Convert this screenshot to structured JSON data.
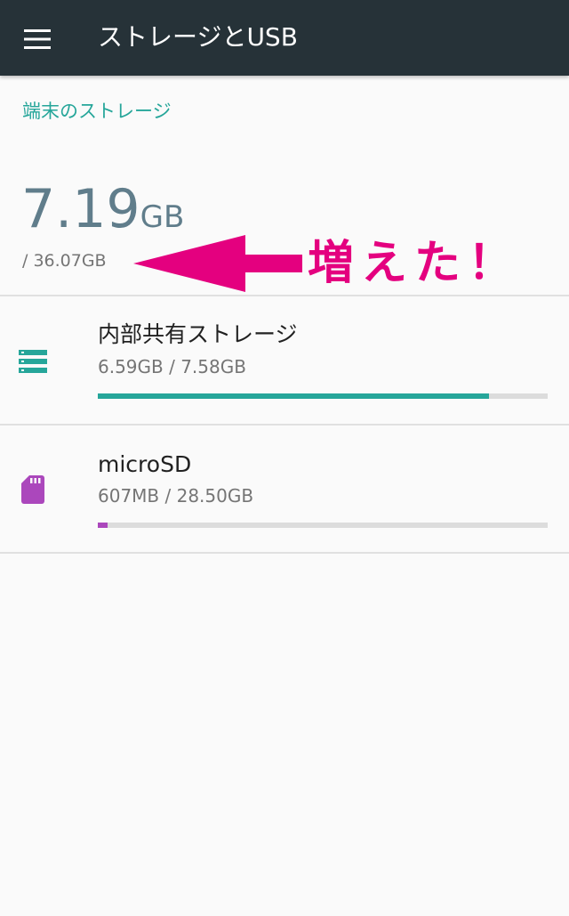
{
  "appbar": {
    "title": "ストレージとUSB",
    "menu_icon": "hamburger-menu-icon"
  },
  "device_storage": {
    "header": "端末のストレージ",
    "used_value": "7.19",
    "used_unit": "GB",
    "total": "/ 36.07GB"
  },
  "annotation": {
    "text": "増えた！",
    "color": "#e4007f",
    "arrow_icon": "left-arrow-icon"
  },
  "volumes": [
    {
      "title": "内部共有ストレージ",
      "summary": "6.59GB / 7.58GB",
      "used_fraction": 0.87,
      "icon": "storage-list-icon",
      "color": "#26a69a"
    },
    {
      "title": "microSD",
      "summary": "607MB / 28.50GB",
      "used_fraction": 0.021,
      "icon": "sd-card-icon",
      "color": "#ab47bc"
    }
  ],
  "colors": {
    "appbar": "#263238",
    "accent": "#26a69a",
    "summary_text": "#607d8b"
  }
}
